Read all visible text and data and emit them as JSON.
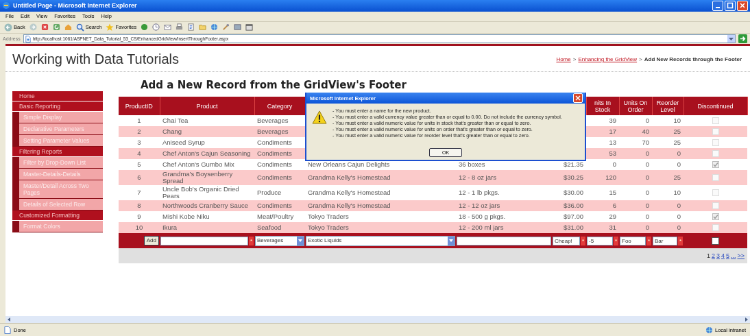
{
  "window": {
    "title": "Untitled Page - Microsoft Internet Explorer"
  },
  "menu": [
    "File",
    "Edit",
    "View",
    "Favorites",
    "Tools",
    "Help"
  ],
  "toolbar": {
    "back": "Back",
    "search": "Search",
    "favorites": "Favorites"
  },
  "address_bar": {
    "label": "Address",
    "url": "http://localhost:1061/ASPNET_Data_Tutorial_53_CS/EnhancedGridView/InsertThroughFooter.aspx"
  },
  "site_title": "Working with Data Tutorials",
  "breadcrumb": [
    {
      "kind": "link",
      "text": "Home"
    },
    {
      "kind": "separator",
      "text": ">"
    },
    {
      "kind": "link",
      "text": "Enhancing the GridView"
    },
    {
      "kind": "separator",
      "text": ">"
    },
    {
      "kind": "current",
      "text": "Add New Records through the Footer"
    }
  ],
  "sidebar": {
    "items": [
      {
        "label": "Home"
      },
      {
        "label": "Basic Reporting",
        "children": [
          {
            "label": "Simple Display"
          },
          {
            "label": "Declarative Parameters"
          },
          {
            "label": "Setting Parameter Values"
          }
        ]
      },
      {
        "label": "Filtering Reports",
        "children": [
          {
            "label": "Filter by Drop-Down List"
          },
          {
            "label": "Master-Details-Details"
          },
          {
            "label": "Master/Detail Across Two Pages"
          },
          {
            "label": "Details of Selected Row"
          }
        ]
      },
      {
        "label": "Customized Formatting",
        "children": [
          {
            "label": "Format Colors"
          }
        ]
      }
    ]
  },
  "heading": "Add a New Record from the GridView's Footer",
  "table": {
    "header": {
      "product_id": "ProductID",
      "product": "Product",
      "category": "Category",
      "units_in_stock": "nits In Stock",
      "units_on_order": "Units On Order",
      "reorder_level": "Reorder Level",
      "discontinued": "Discontinued"
    },
    "rows": [
      {
        "product_id": "1",
        "product": "Chai Tea",
        "category": "Beverages",
        "units_in_stock": "39",
        "units_on_order": "0",
        "reorder_level": "10",
        "discontinued": false
      },
      {
        "product_id": "2",
        "product": "Chang",
        "category": "Beverages",
        "units_in_stock": "17",
        "units_on_order": "40",
        "reorder_level": "25",
        "discontinued": false
      },
      {
        "product_id": "3",
        "product": "Aniseed Syrup",
        "category": "Condiments",
        "units_in_stock": "13",
        "units_on_order": "70",
        "reorder_level": "25",
        "discontinued": false
      },
      {
        "product_id": "4",
        "product": "Chef Anton's Cajun Seasoning",
        "category": "Condiments",
        "units_in_stock": "53",
        "units_on_order": "0",
        "reorder_level": "0",
        "discontinued": false
      },
      {
        "product_id": "5",
        "product": "Chef Anton's Gumbo Mix",
        "category": "Condiments",
        "supplier": "New Orleans Cajun Delights",
        "quantity_per_unit": "36 boxes",
        "unit_price": "$21.35",
        "units_in_stock": "0",
        "units_on_order": "0",
        "reorder_level": "0",
        "discontinued": true
      },
      {
        "product_id": "6",
        "product": "Grandma's Boysenberry Spread",
        "category": "Condiments",
        "supplier": "Grandma Kelly's Homestead",
        "quantity_per_unit": "12 - 8 oz jars",
        "unit_price": "$30.25",
        "units_in_stock": "120",
        "units_on_order": "0",
        "reorder_level": "25",
        "discontinued": false
      },
      {
        "product_id": "7",
        "product": "Uncle Bob's Organic Dried Pears",
        "category": "Produce",
        "supplier": "Grandma Kelly's Homestead",
        "quantity_per_unit": "12 - 1 lb pkgs.",
        "unit_price": "$30.00",
        "units_in_stock": "15",
        "units_on_order": "0",
        "reorder_level": "10",
        "discontinued": false
      },
      {
        "product_id": "8",
        "product": "Northwoods Cranberry Sauce",
        "category": "Condiments",
        "supplier": "Grandma Kelly's Homestead",
        "quantity_per_unit": "12 - 12 oz jars",
        "unit_price": "$36.00",
        "units_in_stock": "6",
        "units_on_order": "0",
        "reorder_level": "0",
        "discontinued": false
      },
      {
        "product_id": "9",
        "product": "Mishi Kobe Niku",
        "category": "Meat/Poultry",
        "supplier": "Tokyo Traders",
        "quantity_per_unit": "18 - 500 g pkgs.",
        "unit_price": "$97.00",
        "units_in_stock": "29",
        "units_on_order": "0",
        "reorder_level": "0",
        "discontinued": true
      },
      {
        "product_id": "10",
        "product": "Ikura",
        "category": "Seafood",
        "supplier": "Tokyo Traders",
        "quantity_per_unit": "12 - 200 ml jars",
        "unit_price": "$31.00",
        "units_in_stock": "31",
        "units_on_order": "0",
        "reorder_level": "0",
        "discontinued": false
      }
    ],
    "footer": [
      {
        "kind": "button",
        "label": "Add"
      },
      {
        "kind": "text",
        "validator": "*"
      },
      {
        "kind": "select",
        "value": "Beverages"
      },
      {
        "kind": "select",
        "value": "Exotic Liquids"
      },
      {
        "kind": "text"
      },
      {
        "kind": "text",
        "value": "Cheap!",
        "validator": "*"
      },
      {
        "kind": "text",
        "value": "-5",
        "validator": "*"
      },
      {
        "kind": "text",
        "value": "Foo",
        "validator": "*"
      },
      {
        "kind": "text",
        "value": "Bar",
        "validator": "*"
      },
      {
        "kind": "checkbox",
        "checked": false
      }
    ],
    "pager": [
      {
        "label": "1",
        "selected": true
      },
      {
        "label": "2",
        "selected": false
      },
      {
        "label": "3",
        "selected": false
      },
      {
        "label": "4",
        "selected": false
      },
      {
        "label": "5",
        "selected": false
      },
      {
        "label": "...",
        "selected": false
      },
      {
        "label": ">>",
        "selected": false
      }
    ]
  },
  "dialog": {
    "title": "Microsoft Internet Explorer",
    "messages": [
      "- You must enter a name for the new product.",
      "- You must enter a valid currency value greater than or equal to 0.00. Do not include the currency symbol.",
      "- You must enter a valid numeric value for units in stock that's greater than or equal to zero.",
      "- You must enter a valid numeric value for units on order that's greater than or equal to zero.",
      "- You must enter a valid numeric value for reorder level that's greater than or equal to zero."
    ],
    "button": "OK"
  },
  "status_bar": {
    "status": "Done",
    "zone": "Local intranet"
  }
}
